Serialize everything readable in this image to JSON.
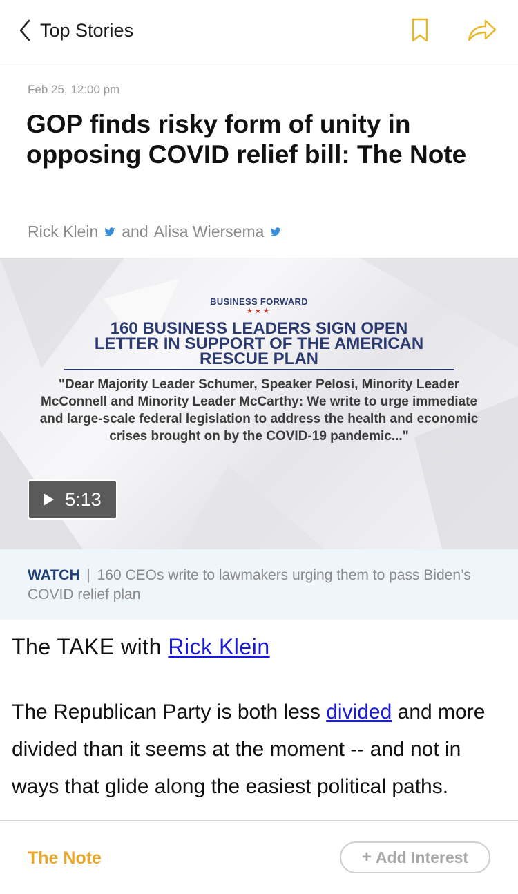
{
  "nav": {
    "back_label": "Top Stories",
    "bookmark_icon": "bookmark-icon",
    "share_icon": "share-icon",
    "accent_color": "#e8b82a"
  },
  "article": {
    "date": "Feb 25, 12:00 pm",
    "headline": "GOP finds risky form of unity in opposing COVID relief bill: The Note",
    "authors": [
      {
        "name": "Rick Klein",
        "icon": "twitter-icon"
      },
      {
        "name": "Alisa Wiersema",
        "icon": "twitter-icon"
      }
    ],
    "byline_joiner": "and"
  },
  "video": {
    "thumb_brand": "BUSINESS FORWARD",
    "thumb_stars": "★★★",
    "thumb_headline": "160 BUSINESS LEADERS SIGN OPEN LETTER IN SUPPORT OF THE AMERICAN RESCUE PLAN",
    "thumb_quote": "\"Dear Majority Leader Schumer, Speaker Pelosi, Minority Leader McConnell and Minority Leader McCarthy: We write to urge immediate and large-scale federal legislation to address the health and economic crises brought on by the COVID-19 pandemic...\"",
    "duration": "5:13",
    "play_icon": "play-icon"
  },
  "caption": {
    "watch_label": "WATCH",
    "separator": "|",
    "text": "160 CEOs write to lawmakers urging them to pass Biden’s COVID relief plan"
  },
  "body": {
    "take_prefix": "The TAKE with ",
    "take_author_link": "Rick Klein",
    "para_before": "The Republican Party is both less ",
    "para_link": "divided",
    "para_after": " and more divided than it seems at the moment -- and not in ways that glide along the easiest political paths."
  },
  "footer": {
    "section_label": "The Note",
    "add_interest_plus": "+",
    "add_interest_label": "Add Interest"
  }
}
